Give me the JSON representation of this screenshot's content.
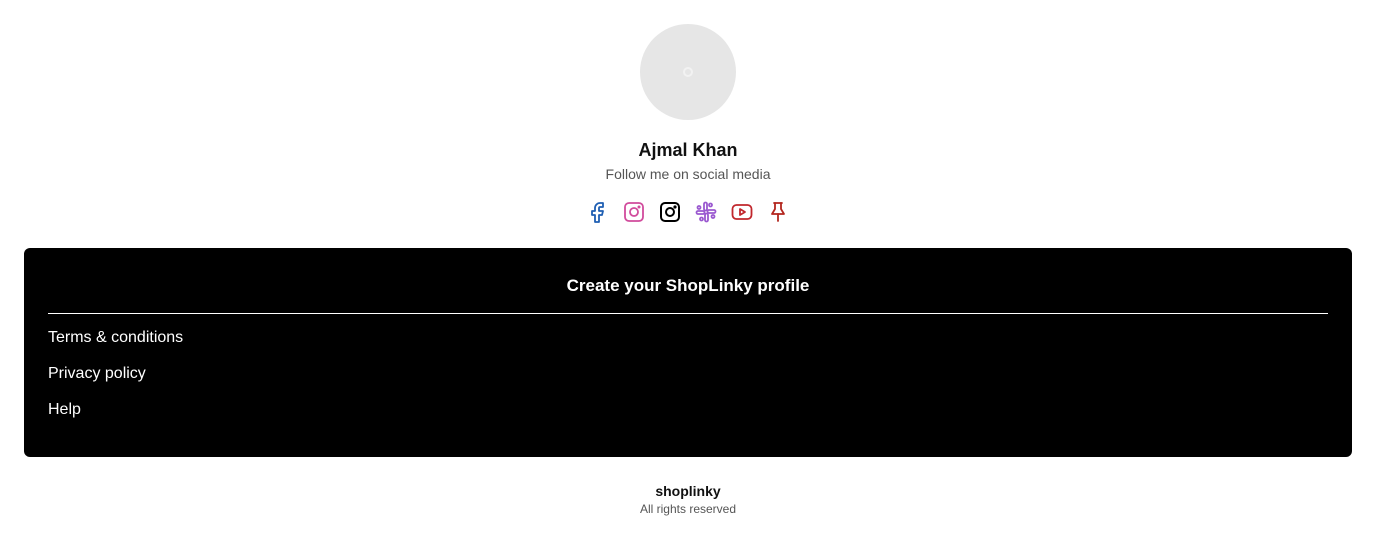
{
  "profile": {
    "name": "Ajmal Khan",
    "subtitle": "Follow me on social media"
  },
  "socials": [
    {
      "icon": "facebook-icon",
      "color": "#1f5fb3"
    },
    {
      "icon": "instagram-icon",
      "color": "#d14b9c"
    },
    {
      "icon": "instagram-outline-icon",
      "color": "#000000"
    },
    {
      "icon": "slack-icon",
      "color": "#9b59d0"
    },
    {
      "icon": "youtube-icon",
      "color": "#c1272d"
    },
    {
      "icon": "pin-icon",
      "color": "#b3261e"
    }
  ],
  "card": {
    "cta_label": "Create your ShopLinky profile",
    "links": [
      "Terms & conditions",
      "Privacy policy",
      "Help"
    ],
    "background": "#000000"
  },
  "footer": {
    "brand": "shoplinky",
    "rights": "All rights reserved"
  }
}
